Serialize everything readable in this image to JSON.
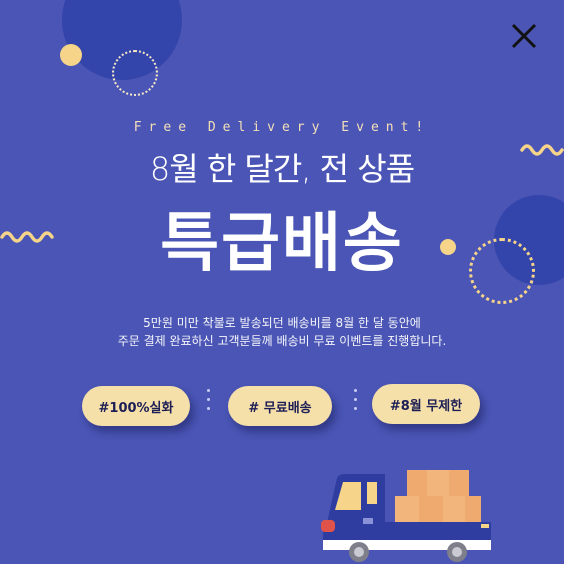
{
  "header": {
    "eyebrow": "Free Delivery Event!",
    "subtitle": "8월 한 달간, 전 상품",
    "title": "특급배송"
  },
  "description": {
    "line1": "5만원 미만 착불로 발송되던 배송비를 8월 한 달 동안에",
    "line2": "주문 결제 완료하신 고객분들께 배송비 무료 이벤트를 진행합니다."
  },
  "tags": [
    {
      "label": "#100%실화"
    },
    {
      "label": "# 무료배송"
    },
    {
      "label": "#8월 무제한"
    }
  ],
  "colors": {
    "background": "#4a55b5",
    "accent_yellow": "#f6d48a",
    "pill": "#f6e0aa",
    "dark_circle": "#3344aa"
  },
  "icons": {
    "close": "close-icon",
    "truck": "delivery-truck-icon"
  }
}
